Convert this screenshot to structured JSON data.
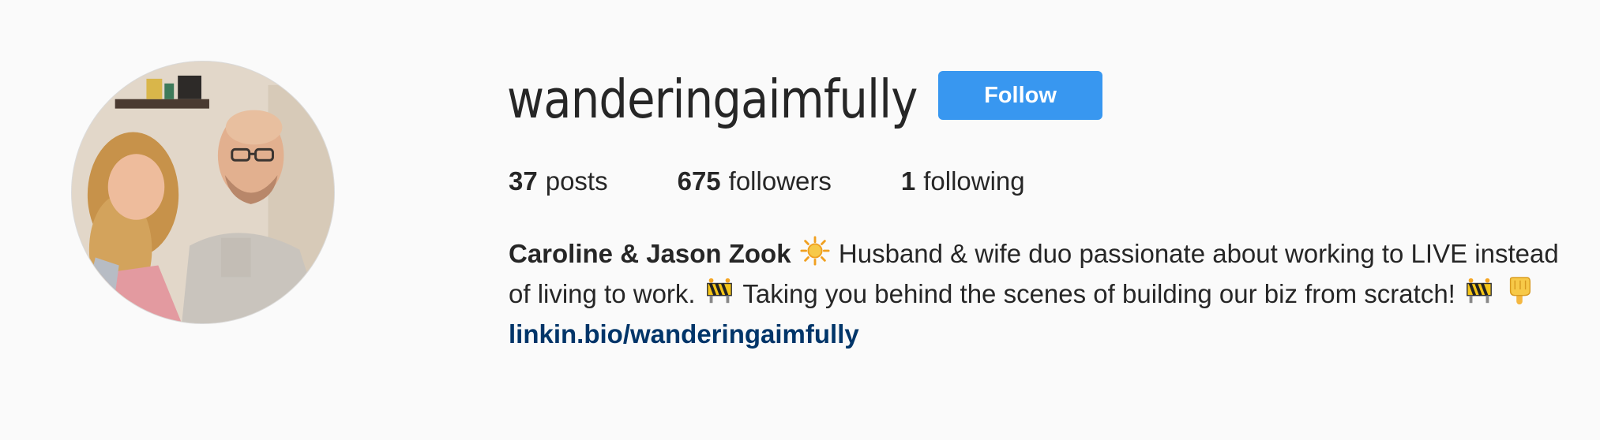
{
  "profile": {
    "username": "wanderingaimfully",
    "follow_label": "Follow",
    "stats": {
      "posts_count": "37",
      "posts_label": "posts",
      "followers_count": "675",
      "followers_label": "followers",
      "following_count": "1",
      "following_label": "following"
    },
    "bio": {
      "full_name": "Caroline & Jason Zook",
      "line_part1": " Husband & wife duo passionate about working to LIVE instead of living to work. ",
      "line_part2": " Taking you behind the scenes of building our biz from scratch! ",
      "emoji_1": "sun-icon",
      "emoji_2": "construction-icon",
      "emoji_3": "construction-icon",
      "emoji_4": "pointing-down-icon"
    },
    "link": "linkin.bio/wanderingaimfully"
  },
  "colors": {
    "background": "#fafafa",
    "text": "#262626",
    "follow_button": "#3897f0",
    "link": "#003569"
  }
}
